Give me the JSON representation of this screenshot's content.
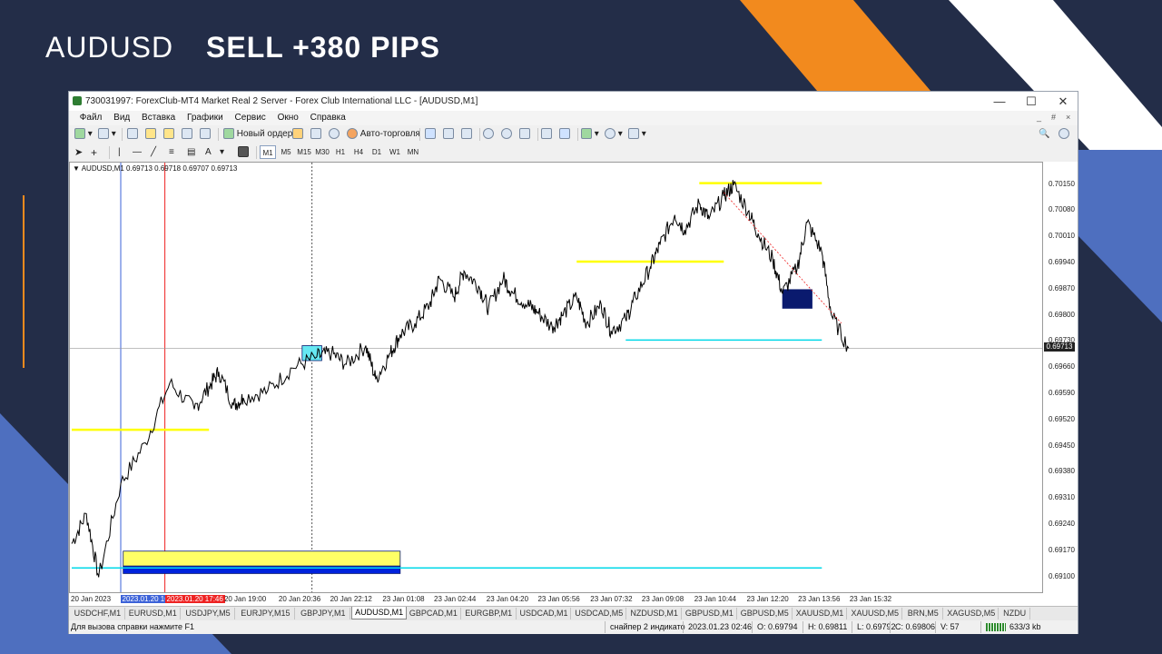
{
  "banner": {
    "pair": "AUDUSD",
    "result": "SELL +380 PIPS",
    "colors": {
      "background": "#232d48",
      "orange": "#f28a1e",
      "white": "#ffffff",
      "blue": "#4e6fbf"
    }
  },
  "window": {
    "title": "730031997: ForexClub-MT4 Market Real 2 Server - Forex Club International LLC - [AUDUSD,M1]",
    "minimize": "—",
    "maximize": "☐",
    "close": "✕"
  },
  "menu": {
    "items": [
      "Файл",
      "Вид",
      "Вставка",
      "Графики",
      "Сервис",
      "Окно",
      "Справка"
    ],
    "mdi_controls": [
      "_",
      "#",
      "×"
    ]
  },
  "toolbar1": {
    "new_order": "Новый ордер",
    "auto_trading": "Авто-торговля"
  },
  "toolbar2": {
    "timeframes": [
      "M1",
      "M5",
      "M15",
      "M30",
      "H1",
      "H4",
      "D1",
      "W1",
      "MN"
    ],
    "active_timeframe": "M1",
    "text_tool": "A"
  },
  "chart": {
    "info": "▼ AUDUSD,M1  0.69713 0.69718 0.69707 0.69713",
    "current_price": "0.69713",
    "colors": {
      "price_line": "#000000",
      "level_yellow": "#ffff00",
      "level_cyan": "#00d8e8",
      "zone_navy": "#0a1a6e",
      "bear_red": "#ee2222",
      "cursor_blue": "#3c62d8"
    }
  },
  "chart_data": {
    "type": "line",
    "symbol": "AUDUSD",
    "timeframe": "M1",
    "ylim": [
      0.6906,
      0.7021
    ],
    "y_ticks": [
      "0.70150",
      "0.70080",
      "0.70010",
      "0.69940",
      "0.69870",
      "0.69800",
      "0.69730",
      "0.69660",
      "0.69590",
      "0.69520",
      "0.69450",
      "0.69380",
      "0.69310",
      "0.69240",
      "0.69170",
      "0.69100"
    ],
    "x_ticks": [
      "20 Jan 2023",
      "2023.01.20 16:09",
      "2023.01.20 17:46",
      "20 Jan 19:00",
      "20 Jan 20:36",
      "20 Jan 22:12",
      "23 Jan 01:08",
      "23 Jan 02:44",
      "23 Jan 04:20",
      "23 Jan 05:56",
      "23 Jan 07:32",
      "23 Jan 09:08",
      "23 Jan 10:44",
      "23 Jan 12:20",
      "23 Jan 13:56",
      "23 Jan 15:32"
    ],
    "x": [
      0,
      0.3,
      0.55,
      1,
      1.5,
      2,
      2.5,
      2.8,
      3,
      3.3,
      3.5,
      4,
      4.5,
      5,
      5.3,
      5.6,
      6,
      6.2,
      6.5,
      6.7,
      7,
      7.3,
      7.5,
      7.8,
      8,
      8.3,
      8.5,
      8.8,
      9,
      9.3,
      9.5,
      9.8,
      10,
      10.3,
      10.5,
      10.8,
      11,
      11.3,
      11.5,
      11.8,
      12,
      12.3,
      12.5,
      12.8,
      13,
      13.3,
      13.5,
      13.8,
      14,
      14.3,
      14.5,
      14.8,
      15,
      15.3,
      15.5,
      15.85
    ],
    "values": [
      0.6919,
      0.6927,
      0.691,
      0.6935,
      0.6946,
      0.6962,
      0.6955,
      0.6961,
      0.6965,
      0.6956,
      0.6958,
      0.696,
      0.6966,
      0.6969,
      0.697,
      0.6967,
      0.6972,
      0.6963,
      0.697,
      0.6975,
      0.6978,
      0.6983,
      0.699,
      0.6985,
      0.6992,
      0.6988,
      0.6982,
      0.699,
      0.6986,
      0.6983,
      0.6981,
      0.6977,
      0.698,
      0.6985,
      0.6978,
      0.6983,
      0.6976,
      0.6979,
      0.6985,
      0.6993,
      0.6999,
      0.7007,
      0.7003,
      0.701,
      0.7006,
      0.7012,
      0.7015,
      0.7008,
      0.7002,
      0.6995,
      0.6986,
      0.6993,
      0.7005,
      0.6997,
      0.698,
      0.69713
    ],
    "levels": [
      {
        "price": 0.69495,
        "x_from": 0,
        "x_to": 2.8
      },
      {
        "price": 0.69945,
        "x_from": 10.3,
        "x_to": 13.3
      },
      {
        "price": 0.70155,
        "x_from": 12.8,
        "x_to": 15.3
      }
    ],
    "support_levels": [
      {
        "price": 0.69735,
        "x_from": 11.3,
        "x_to": 15.3
      },
      {
        "price": 0.69125,
        "x_from": 0,
        "x_to": 15.3
      }
    ],
    "zones": [
      {
        "y_from": 0.6913,
        "y_to": 0.6917,
        "x_from": 1.05,
        "x_to": 6.7,
        "fill": "#ffff66"
      },
      {
        "y_from": 0.6911,
        "y_to": 0.6913,
        "x_from": 1.05,
        "x_to": 6.7,
        "fill": "#0022dd"
      },
      {
        "y_from": 0.6982,
        "y_to": 0.6987,
        "x_from": 14.5,
        "x_to": 15.1,
        "fill": "#0a1a6e"
      },
      {
        "y_from": 0.6968,
        "y_to": 0.6972,
        "x_from": 4.7,
        "x_to": 5.1,
        "fill": "#66e8f2"
      }
    ]
  },
  "symbol_tabs": {
    "items": [
      "USDCHF,M1",
      "EURUSD,M1",
      "USDJPY,M5",
      "EURJPY,M15",
      "GBPJPY,M1",
      "AUDUSD,M1",
      "GBPCAD,M1",
      "EURGBP,M1",
      "USDCAD,M1",
      "USDCAD,M5",
      "NZDUSD,M1",
      "GBPUSD,M1",
      "GBPUSD,M5",
      "XAUUSD,M1",
      "XAUUSD,M5",
      "BRN,M5",
      "XAGUSD,M5",
      "NZDU"
    ],
    "active": "AUDUSD,M1"
  },
  "status": {
    "help": "Для вызова справки нажмите F1",
    "profile": "снайпер 2 индикато",
    "datetime": "2023.01.23 02:46",
    "open": "O: 0.69794",
    "high": "H: 0.69811",
    "low": "L: 0.69792",
    "close": "C: 0.69806",
    "volume": "V: 57",
    "traffic": "633/3 kb"
  }
}
